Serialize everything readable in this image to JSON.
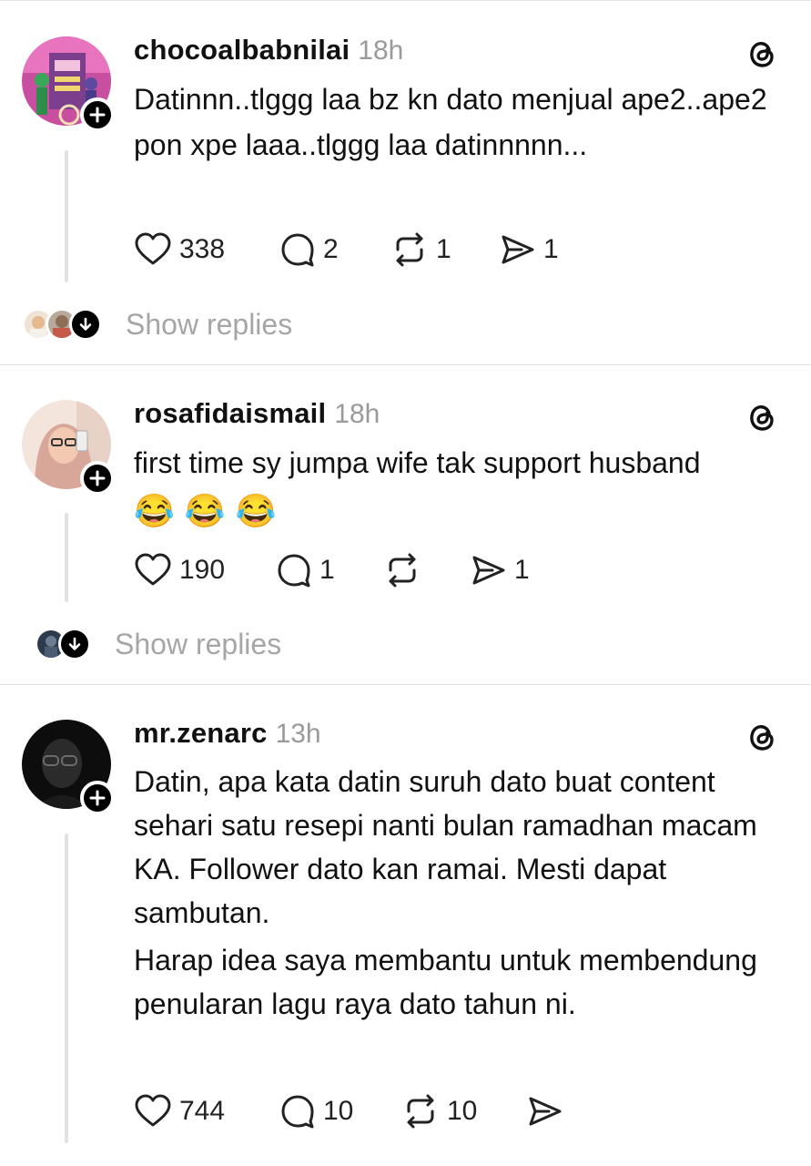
{
  "posts": [
    {
      "username": "chocoalbabnilai",
      "time": "18h",
      "text": [
        "Datinnn..tlggg laa bz kn dato menjual ape2..ape2 pon xpe laaa..tlggg laa datinnnnn..."
      ],
      "emojis": [],
      "likes": "338",
      "replies": "2",
      "reposts": "1",
      "shares": "1",
      "show_replies": "Show replies",
      "avatar_colors": [
        "#d94fa6",
        "#7a3d8c"
      ]
    },
    {
      "username": "rosafidaismail",
      "time": "18h",
      "text": [
        "first time sy jumpa wife tak support husband"
      ],
      "emojis": [
        "😂",
        "😂",
        "😂"
      ],
      "likes": "190",
      "replies": "1",
      "reposts": "",
      "shares": "1",
      "show_replies": "Show replies",
      "avatar_colors": [
        "#e9b9a8",
        "#c98f86"
      ]
    },
    {
      "username": "mr.zenarc",
      "time": "13h",
      "text": [
        "Datin, apa kata datin suruh dato buat content sehari satu resepi nanti bulan ramadhan macam KA. Follower dato kan ramai. Mesti dapat sambutan.",
        "Harap idea saya membantu untuk membendung penularan lagu raya dato tahun ni."
      ],
      "emojis": [],
      "likes": "744",
      "replies": "10",
      "reposts": "10",
      "shares": "",
      "avatar_colors": [
        "#1a1a1a",
        "#3a3a3a"
      ]
    }
  ]
}
